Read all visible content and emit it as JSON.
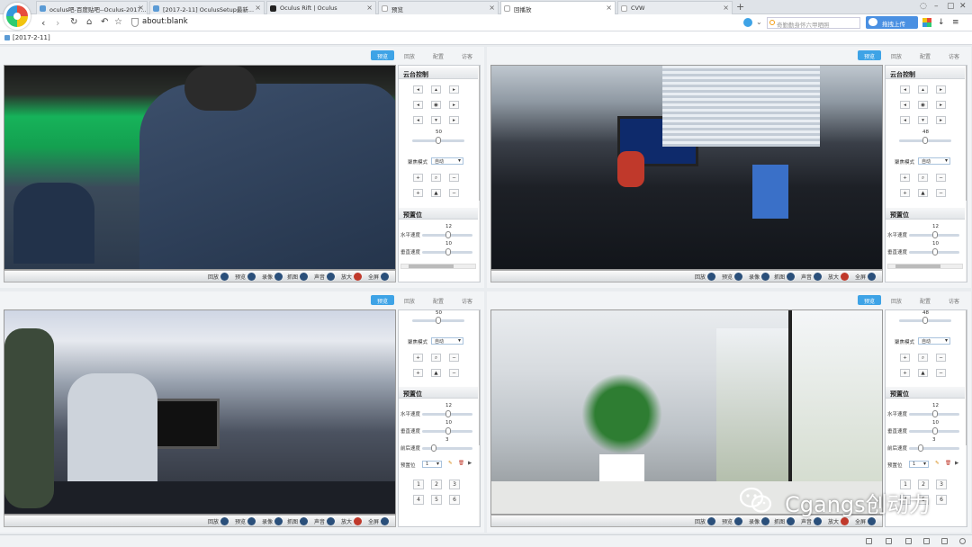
{
  "tabs": [
    {
      "label": "oculus吧-百度贴吧--Oculus-2017...",
      "active": false
    },
    {
      "label": "[2017-2-11] OculusSetup最新...",
      "active": false
    },
    {
      "label": "Oculus Rift | Oculus",
      "active": false
    },
    {
      "label": "预览",
      "active": false
    },
    {
      "label": "回播放",
      "active": true
    },
    {
      "label": "CVW",
      "active": false
    }
  ],
  "address": {
    "url": "about:blank",
    "search_placeholder": "奇勤勤身怀六甲晒照",
    "upload_label": "拖拽上传"
  },
  "bookmark": {
    "label": "[2017-2-11]"
  },
  "quad_tabs": [
    "预览",
    "回放",
    "配置",
    "访客"
  ],
  "ctrl": {
    "items": [
      "回放",
      "预览",
      "录像",
      "抓图",
      "声音",
      "放大",
      "全屏"
    ]
  },
  "ptz": {
    "title": "云台控制",
    "zoom_value_1": "50",
    "zoom_value_2": "48",
    "focus_mode_label": "聚焦模式",
    "focus_mode": "自动",
    "preset_title": "预置位",
    "hspeed_label": "水平速度",
    "hspeed": "12",
    "vspeed_label": "垂直速度",
    "vspeed": "10",
    "fspeed_label": "前后速度",
    "fspeed": "3",
    "preset_label": "预置位",
    "preset_value": "1",
    "zoom_value_3": "50",
    "zoom_value_4": "48"
  },
  "presets": [
    "1",
    "2",
    "3",
    "4",
    "5",
    "6"
  ],
  "watermark": {
    "text": "Cgangs创动力"
  },
  "colors": {
    "accent": "#3ea3e6",
    "upload": "#4a90e2"
  }
}
